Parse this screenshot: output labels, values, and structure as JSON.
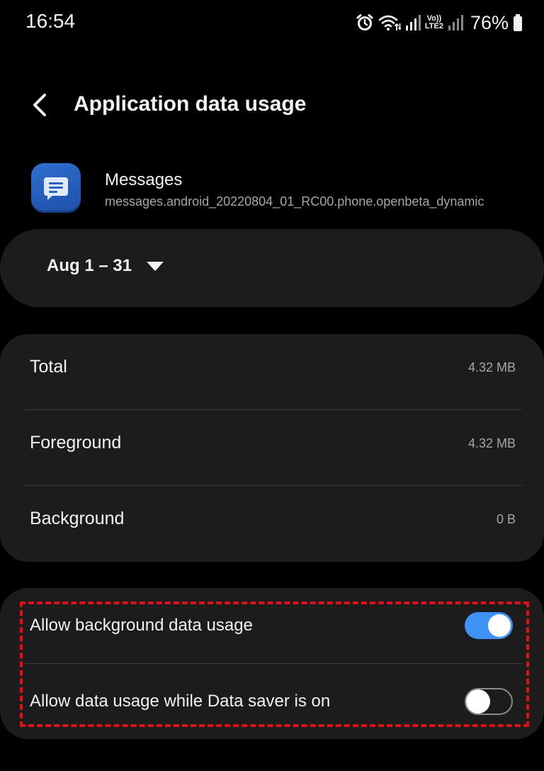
{
  "status_bar": {
    "time": "16:54",
    "volte_top": "Vo))",
    "volte_bottom": "LTE2",
    "battery": "76%",
    "icons": [
      "alarm-icon",
      "wifi-icon",
      "signal-icon",
      "volte-icon",
      "signal-icon",
      "battery-icon"
    ]
  },
  "header": {
    "title": "Application data usage",
    "back_icon": "back-arrow-icon"
  },
  "app": {
    "name": "Messages",
    "package": "messages.android_20220804_01_RC00.phone.openbeta_dynamic",
    "icon": "messages-app-icon",
    "icon_color": "#2563c0"
  },
  "period": {
    "label": "Aug 1 – 31",
    "dropdown_icon": "dropdown-triangle-icon"
  },
  "usage": {
    "rows": [
      {
        "label": "Total",
        "value": "4.32 MB"
      },
      {
        "label": "Foreground",
        "value": "4.32 MB"
      },
      {
        "label": "Background",
        "value": "0 B"
      }
    ]
  },
  "toggles": {
    "rows": [
      {
        "label": "Allow background data usage",
        "enabled": true
      },
      {
        "label": "Allow data usage while Data saver is on",
        "enabled": false
      }
    ]
  },
  "colors": {
    "background": "#000000",
    "card": "#1c1c1c",
    "accent": "#3e91f5",
    "highlight": "#e0101a",
    "secondary_text": "#a6a6a6"
  }
}
